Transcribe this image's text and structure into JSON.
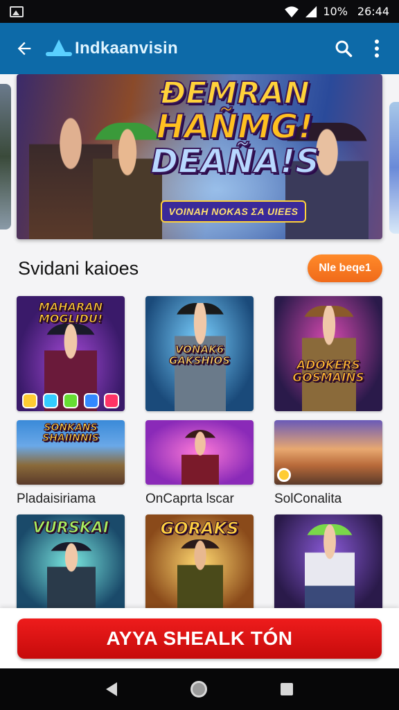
{
  "status_bar": {
    "battery": "10%",
    "time": "26:44"
  },
  "app_bar": {
    "title": "Indkaanvisin"
  },
  "banner": {
    "line1": "ÐEMRAN",
    "line2": "HAÑMG!",
    "line3": "DEAÑA!S",
    "subtitle": "VOINAH NOKAS ΣA UIEES"
  },
  "section": {
    "title": "Svidani kaioes",
    "see_more": "Nle beqe1"
  },
  "games": {
    "row1": [
      {
        "title": "MAHARAN MOGLIDU!"
      },
      {
        "title": "VONAK6 GAKSHIOS"
      },
      {
        "title": "ADOKERS GOSMAINS"
      }
    ],
    "row2": [
      {
        "title": "SONKANS SHAIINNIS",
        "label": "Pladaisiriama"
      },
      {
        "title": "",
        "label": "OnCaprta lscar"
      },
      {
        "title": "",
        "label": "SolConalita"
      }
    ],
    "row3": [
      {
        "title": "VURSKAI"
      },
      {
        "title": "GORAKS"
      },
      {
        "title": ""
      }
    ]
  },
  "cta": {
    "label": "AYYA SHEALK  TÓN"
  },
  "colors": {
    "app_bar": "#0d6aa8",
    "cta": "#e01515",
    "see_more": "#f47a22"
  }
}
